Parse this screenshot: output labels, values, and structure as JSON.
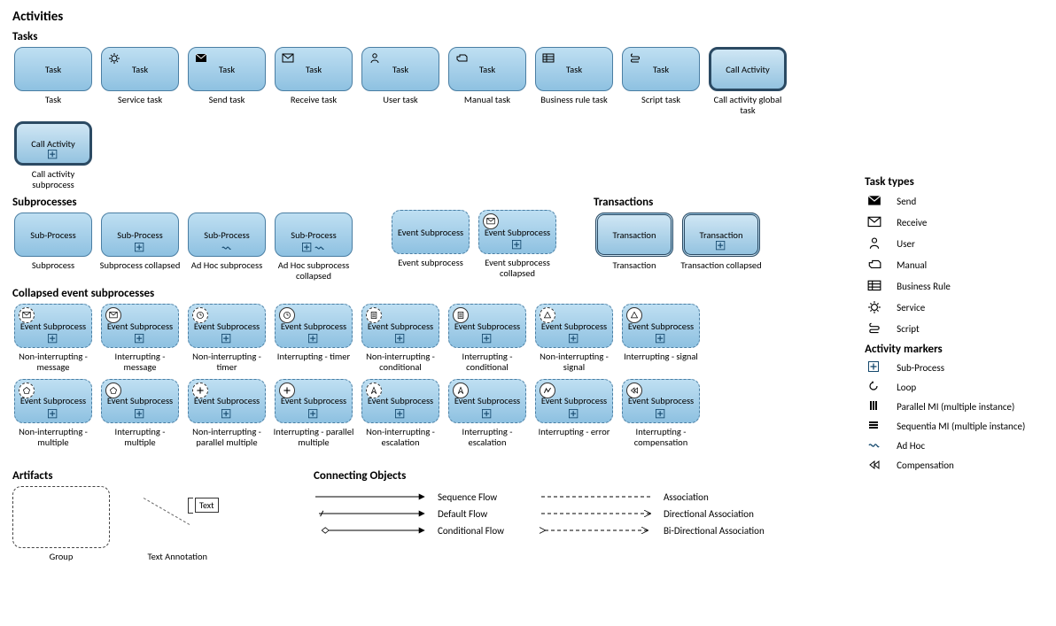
{
  "title": "Activities",
  "sections": {
    "tasks": "Tasks",
    "subprocesses": "Subprocesses",
    "transactions": "Transactions",
    "collapsed": "Collapsed event subprocesses",
    "artifacts": "Artifacts",
    "connecting": "Connecting Objects"
  },
  "tasks": [
    {
      "label": "Task",
      "caption": "Task",
      "icon": null
    },
    {
      "label": "Task",
      "caption": "Service task",
      "icon": "service"
    },
    {
      "label": "Task",
      "caption": "Send task",
      "icon": "send"
    },
    {
      "label": "Task",
      "caption": "Receive task",
      "icon": "receive"
    },
    {
      "label": "Task",
      "caption": "User task",
      "icon": "user"
    },
    {
      "label": "Task",
      "caption": "Manual task",
      "icon": "manual"
    },
    {
      "label": "Task",
      "caption": "Business rule task",
      "icon": "brule"
    },
    {
      "label": "Task",
      "caption": "Script task",
      "icon": "script"
    },
    {
      "label": "Call Activity",
      "caption": "Call activity global task",
      "icon": null,
      "thick": true
    },
    {
      "label": "Call Activity",
      "caption": "Call activity subprocess",
      "icon": null,
      "thick": true,
      "marker": "sub"
    }
  ],
  "subprocesses": [
    {
      "label": "Sub-Process",
      "caption": "Subprocess"
    },
    {
      "label": "Sub-Process",
      "caption": "Subprocess collapsed",
      "marker": "sub"
    },
    {
      "label": "Sub-Process",
      "caption": "Ad Hoc subprocess",
      "marker": "adhoc"
    },
    {
      "label": "Sub-Process",
      "caption": "Ad Hoc subprocess collapsed",
      "marker": "sub-adhoc"
    }
  ],
  "event_sub_simple": [
    {
      "label": "Event Subprocess",
      "caption": "Event subprocess"
    },
    {
      "label": "Event Subprocess",
      "caption": "Event subprocess collapsed",
      "marker": "sub",
      "evt": "receive"
    }
  ],
  "transactions": [
    {
      "label": "Transaction",
      "caption": "Transaction"
    },
    {
      "label": "Transaction",
      "caption": "Transaction collapsed",
      "marker": "sub"
    }
  ],
  "collapsed_row1": [
    {
      "caption": "Non-interrupting - message",
      "evt": "receive",
      "ni": true
    },
    {
      "caption": "Interrupting - message",
      "evt": "receive",
      "ni": false
    },
    {
      "caption": "Non-interrupting - timer",
      "evt": "timer",
      "ni": true
    },
    {
      "caption": "Interrupting - timer",
      "evt": "timer",
      "ni": false
    },
    {
      "caption": "Non-interrupting - conditional",
      "evt": "cond",
      "ni": true
    },
    {
      "caption": "Interrupting - conditional",
      "evt": "cond",
      "ni": false
    },
    {
      "caption": "Non-interrupting - signal",
      "evt": "signal",
      "ni": true
    },
    {
      "caption": "Interrupting - signal",
      "evt": "signal",
      "ni": false
    }
  ],
  "collapsed_row2": [
    {
      "caption": "Non-interrupting - multiple",
      "evt": "mult",
      "ni": true
    },
    {
      "caption": "Interrupting - multiple",
      "evt": "mult",
      "ni": false
    },
    {
      "caption": "Non-interrupting - parallel multiple",
      "evt": "pmult",
      "ni": true
    },
    {
      "caption": "Interrupting - parallel multiple",
      "evt": "pmult",
      "ni": false
    },
    {
      "caption": "Non-interrupting - escalation",
      "evt": "esc",
      "ni": true
    },
    {
      "caption": "Interrupting - escalation",
      "evt": "esc",
      "ni": false
    },
    {
      "caption": "Interrupting - error",
      "evt": "err",
      "ni": false
    },
    {
      "caption": "Interrupting - compensation",
      "evt": "comp",
      "ni": false
    }
  ],
  "es_label": "Event Subprocess",
  "artifacts_items": {
    "group": "Group",
    "text": "Text",
    "anno": "Text Annotation"
  },
  "connecting": [
    {
      "label": "Sequence Flow",
      "kind": "seq"
    },
    {
      "label": "Default Flow",
      "kind": "def"
    },
    {
      "label": "Conditional Flow",
      "kind": "cond"
    }
  ],
  "assoc": [
    {
      "label": "Association",
      "kind": "assoc"
    },
    {
      "label": "Directional Association",
      "kind": "dassoc"
    },
    {
      "label": "Bi-Directional Association",
      "kind": "bassoc"
    }
  ],
  "legend_tasktypes_h": "Task types",
  "legend_tasktypes": [
    {
      "icon": "send",
      "label": "Send"
    },
    {
      "icon": "receive",
      "label": "Receive"
    },
    {
      "icon": "user",
      "label": "User"
    },
    {
      "icon": "manual",
      "label": "Manual"
    },
    {
      "icon": "brule",
      "label": "Business Rule"
    },
    {
      "icon": "service",
      "label": "Service"
    },
    {
      "icon": "script",
      "label": "Script"
    }
  ],
  "legend_markers_h": "Activity markers",
  "legend_markers": [
    {
      "icon": "sub",
      "label": "Sub-Process"
    },
    {
      "icon": "loop",
      "label": "Loop"
    },
    {
      "icon": "pmi",
      "label": "Parallel MI (multiple instance)"
    },
    {
      "icon": "smi",
      "label": "Sequentia MI (multiple instance)"
    },
    {
      "icon": "adhoc",
      "label": "Ad Hoc"
    },
    {
      "icon": "comp",
      "label": "Compensation"
    }
  ]
}
